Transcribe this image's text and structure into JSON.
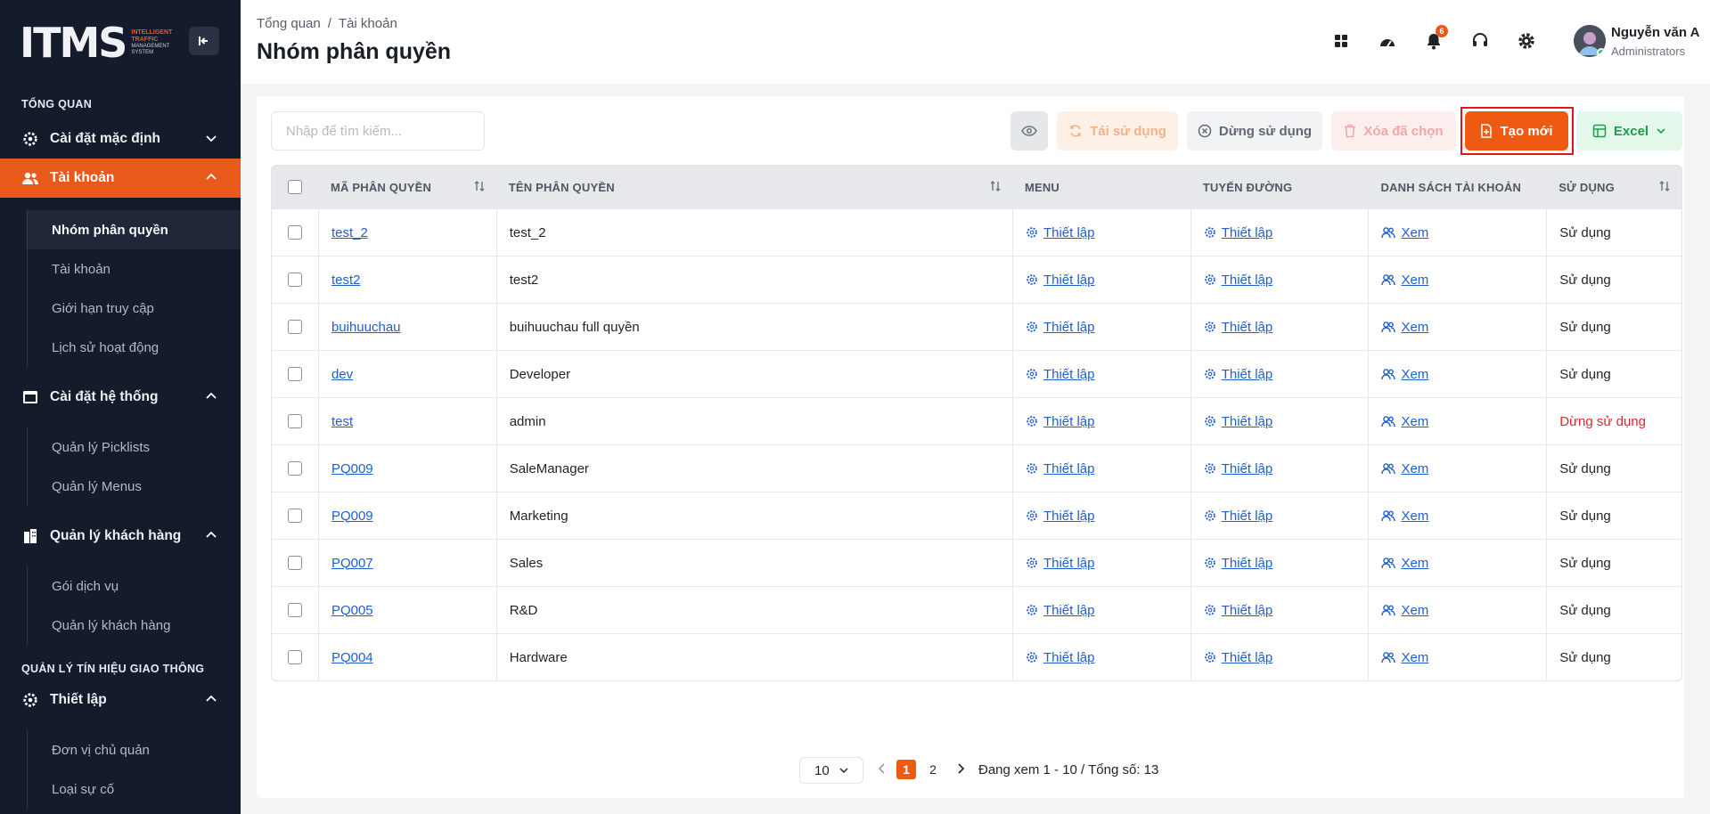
{
  "brand": {
    "logo": "ITMS",
    "line1": "INTELLIGENT",
    "line2": "TRAFFIC",
    "line3": "MANAGEMENT",
    "line4": "SYSTEM"
  },
  "sidebar": {
    "section_overview": "TỔNG QUAN",
    "group_default": "Cài đặt mặc định",
    "group_account": "Tài khoản",
    "account_items": [
      "Nhóm phân quyền",
      "Tài khoản",
      "Giới hạn truy cập",
      "Lịch sử hoạt động"
    ],
    "group_system": "Cài đặt hệ thống",
    "system_items": [
      "Quản lý Picklists",
      "Quản lý Menus"
    ],
    "group_customer": "Quản lý khách hàng",
    "customer_items": [
      "Gói dịch vụ",
      "Quản lý khách hàng"
    ],
    "section_signal": "QUẢN LÝ TÍN HIỆU GIAO THÔNG",
    "group_setup": "Thiết lập",
    "setup_items": [
      "Đơn vị chủ quản",
      "Loại sự cố"
    ]
  },
  "header": {
    "breadcrumb": [
      "Tổng quan",
      "/",
      "Tài khoản"
    ],
    "title": "Nhóm phân quyền",
    "notification_count": "6",
    "user_name": "Nguyễn văn A",
    "user_role": "Administrators"
  },
  "toolbar": {
    "search_placeholder": "Nhập để tìm kiếm...",
    "reuse": "Tái sử dụng",
    "stop": "Dừng sử dụng",
    "delete": "Xóa đã chọn",
    "create": "Tạo mới",
    "excel": "Excel"
  },
  "table": {
    "headers": [
      "MÃ PHÂN QUYỀN",
      "TÊN PHÂN QUYỀN",
      "MENU",
      "TUYẾN ĐƯỜNG",
      "DANH SÁCH TÀI KHOẢN",
      "SỬ DỤNG"
    ],
    "rows": [
      {
        "code": "test_2",
        "name": "test_2",
        "menu": "Thiết lập",
        "route": "Thiết lập",
        "accounts": "Xem",
        "status": "Sử dụng",
        "active": true
      },
      {
        "code": "test2",
        "name": "test2",
        "menu": "Thiết lập",
        "route": "Thiết lập",
        "accounts": "Xem",
        "status": "Sử dụng",
        "active": true
      },
      {
        "code": "buihuuchau",
        "name": "buihuuchau full quyền",
        "menu": "Thiết lập",
        "route": "Thiết lập",
        "accounts": "Xem",
        "status": "Sử dụng",
        "active": true
      },
      {
        "code": "dev",
        "name": "Developer",
        "menu": "Thiết lập",
        "route": "Thiết lập",
        "accounts": "Xem",
        "status": "Sử dụng",
        "active": true
      },
      {
        "code": "test",
        "name": "admin",
        "menu": "Thiết lập",
        "route": "Thiết lập",
        "accounts": "Xem",
        "status": "Dừng sử dụng",
        "active": false
      },
      {
        "code": "PQ009",
        "name": "SaleManager",
        "menu": "Thiết lập",
        "route": "Thiết lập",
        "accounts": "Xem",
        "status": "Sử dụng",
        "active": true
      },
      {
        "code": "PQ009",
        "name": "Marketing",
        "menu": "Thiết lập",
        "route": "Thiết lập",
        "accounts": "Xem",
        "status": "Sử dụng",
        "active": true
      },
      {
        "code": "PQ007",
        "name": "Sales",
        "menu": "Thiết lập",
        "route": "Thiết lập",
        "accounts": "Xem",
        "status": "Sử dụng",
        "active": true
      },
      {
        "code": "PQ005",
        "name": "R&D",
        "menu": "Thiết lập",
        "route": "Thiết lập",
        "accounts": "Xem",
        "status": "Sử dụng",
        "active": true
      },
      {
        "code": "PQ004",
        "name": "Hardware",
        "menu": "Thiết lập",
        "route": "Thiết lập",
        "accounts": "Xem",
        "status": "Sử dụng",
        "active": true
      }
    ]
  },
  "pagination": {
    "page_size": "10",
    "pages": [
      "1",
      "2"
    ],
    "current_page": "1",
    "info": "Đang xem 1 - 10 / Tổng số: 13"
  },
  "colors": {
    "accent": "#ee5a12",
    "sidebar_bg": "#141b2b",
    "link": "#1f5fd1",
    "danger": "#e0262b",
    "excel": "#1f9b4b"
  }
}
